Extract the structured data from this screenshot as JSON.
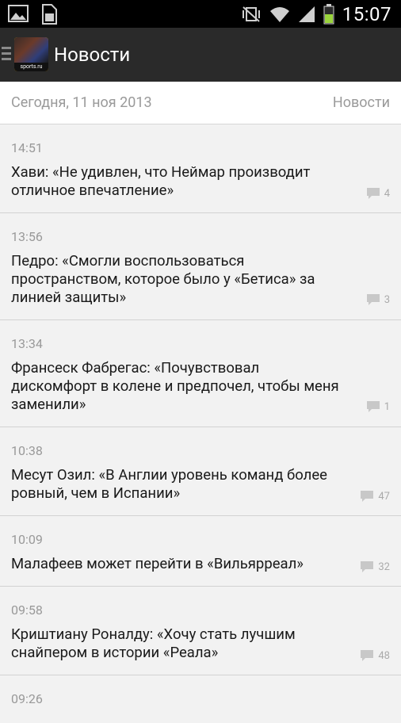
{
  "status_bar": {
    "time": "15:07"
  },
  "action_bar": {
    "title": "Новости",
    "logo_text": "sports.ru"
  },
  "date_header": {
    "date": "Сегодня, 11 ноя 2013",
    "section": "Новости"
  },
  "news": [
    {
      "time": "14:51",
      "headline": "Хави: «Не удивлен, что Неймар производит отличное впечатление»",
      "comments": "4"
    },
    {
      "time": "13:56",
      "headline": "Педро: «Смогли воспользоваться пространством, которое было у «Бетиса» за линией защиты»",
      "comments": "3"
    },
    {
      "time": "13:34",
      "headline": "Франсеск Фабрегас: «Почувствовал дискомфорт в колене и предпочел, чтобы меня заменили»",
      "comments": "1"
    },
    {
      "time": "10:38",
      "headline": "Месут Озил: «В Англии уровень команд более ровный, чем в Испании»",
      "comments": "47"
    },
    {
      "time": "10:09",
      "headline": "Малафеев может перейти в «Вильярреал»",
      "comments": "32"
    },
    {
      "time": "09:58",
      "headline": "Криштиану Роналду: «Хочу стать лучшим снайпером в истории «Реала»",
      "comments": "48"
    },
    {
      "time": "09:26",
      "headline": "",
      "comments": ""
    }
  ]
}
